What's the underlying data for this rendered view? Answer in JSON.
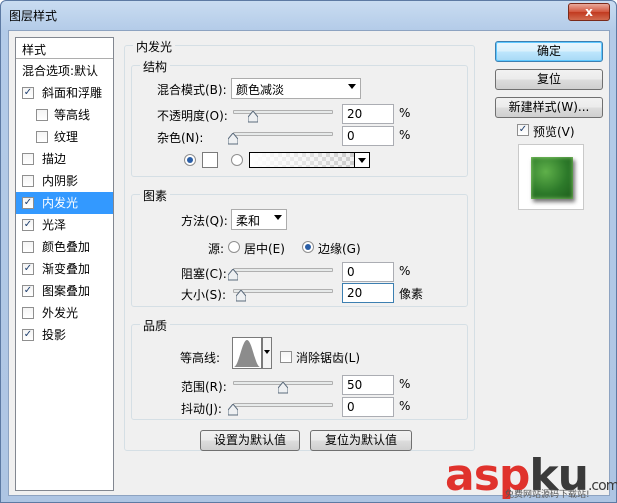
{
  "window": {
    "title": "图层样式",
    "close": "x"
  },
  "sidebar": {
    "header": "样式",
    "items": [
      {
        "label": "混合选项:默认",
        "checkbox": false,
        "checked": false,
        "sub": false,
        "selected": false
      },
      {
        "label": "斜面和浮雕",
        "checkbox": true,
        "checked": true,
        "sub": false,
        "selected": false
      },
      {
        "label": "等高线",
        "checkbox": true,
        "checked": false,
        "sub": true,
        "selected": false
      },
      {
        "label": "纹理",
        "checkbox": true,
        "checked": false,
        "sub": true,
        "selected": false
      },
      {
        "label": "描边",
        "checkbox": true,
        "checked": false,
        "sub": false,
        "selected": false
      },
      {
        "label": "内阴影",
        "checkbox": true,
        "checked": false,
        "sub": false,
        "selected": false
      },
      {
        "label": "内发光",
        "checkbox": true,
        "checked": true,
        "sub": false,
        "selected": true
      },
      {
        "label": "光泽",
        "checkbox": true,
        "checked": true,
        "sub": false,
        "selected": false
      },
      {
        "label": "颜色叠加",
        "checkbox": true,
        "checked": false,
        "sub": false,
        "selected": false
      },
      {
        "label": "渐变叠加",
        "checkbox": true,
        "checked": true,
        "sub": false,
        "selected": false
      },
      {
        "label": "图案叠加",
        "checkbox": true,
        "checked": true,
        "sub": false,
        "selected": false
      },
      {
        "label": "外发光",
        "checkbox": true,
        "checked": false,
        "sub": false,
        "selected": false
      },
      {
        "label": "投影",
        "checkbox": true,
        "checked": true,
        "sub": false,
        "selected": false
      }
    ]
  },
  "panel": {
    "title": "内发光",
    "structure": {
      "title": "结构",
      "blend_mode_label": "混合模式(B):",
      "blend_mode_value": "颜色减淡",
      "opacity_label": "不透明度(O):",
      "opacity_value": "20",
      "opacity_unit": "%",
      "opacity_fraction": 0.2,
      "noise_label": "杂色(N):",
      "noise_value": "0",
      "noise_unit": "%",
      "noise_fraction": 0.0
    },
    "elements": {
      "title": "图素",
      "method_label": "方法(Q):",
      "method_value": "柔和",
      "source_label": "源:",
      "source_center": "居中(E)",
      "source_edge": "边缘(G)",
      "choke_label": "阻塞(C):",
      "choke_value": "0",
      "choke_unit": "%",
      "choke_fraction": 0.0,
      "size_label": "大小(S):",
      "size_value": "20",
      "size_unit": "像素",
      "size_fraction": 0.08
    },
    "quality": {
      "title": "品质",
      "contour_label": "等高线:",
      "anti_alias_label": "消除锯齿(L)",
      "range_label": "范围(R):",
      "range_value": "50",
      "range_unit": "%",
      "range_fraction": 0.5,
      "jitter_label": "抖动(J):",
      "jitter_value": "0",
      "jitter_unit": "%",
      "jitter_fraction": 0.0
    },
    "set_default": "设置为默认值",
    "reset_default": "复位为默认值"
  },
  "right": {
    "ok": "确定",
    "reset": "复位",
    "new_style": "新建样式(W)...",
    "preview_label": "预览(V)",
    "preview_checked": true
  },
  "watermark": {
    "main_a": "asp",
    "main_b": "ku",
    "domain": ".com",
    "sub": "免费网站源码下载站!"
  }
}
